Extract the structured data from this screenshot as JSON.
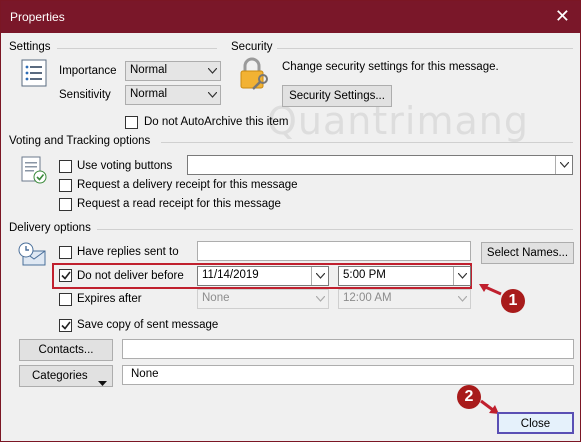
{
  "window": {
    "title": "Properties",
    "close_glyph": "✕"
  },
  "settings": {
    "section_title": "Settings",
    "importance_label": "Importance",
    "importance_value": "Normal",
    "sensitivity_label": "Sensitivity",
    "sensitivity_value": "Normal",
    "autoarchive_label": "Do not AutoArchive this item"
  },
  "security": {
    "section_title": "Security",
    "description": "Change security settings for this message.",
    "button_label": "Security Settings..."
  },
  "voting": {
    "section_title": "Voting and Tracking options",
    "use_voting_label": "Use voting buttons",
    "voting_value": "",
    "delivery_receipt_label": "Request a delivery receipt for this message",
    "read_receipt_label": "Request a read receipt for this message"
  },
  "delivery": {
    "section_title": "Delivery options",
    "replies_label": "Have replies sent to",
    "replies_value": "",
    "select_names_label": "Select Names...",
    "do_not_deliver_label": "Do not deliver before",
    "do_not_deliver_date": "11/14/2019",
    "do_not_deliver_time": "5:00 PM",
    "expires_label": "Expires after",
    "expires_date": "None",
    "expires_time": "12:00 AM",
    "save_copy_label": "Save copy of sent message"
  },
  "contacts": {
    "button_label": "Contacts...",
    "value": ""
  },
  "categories": {
    "button_label": "Categories",
    "value": "None"
  },
  "footer": {
    "close_label": "Close"
  },
  "annotations": {
    "marker_1": "1",
    "marker_2": "2",
    "arrow_color": "#c0202e"
  },
  "watermark": {
    "text": "Quantrimang"
  },
  "colors": {
    "title_bar": "#7a1729",
    "highlight": "#c0202e",
    "badge": "#a81b1b"
  }
}
